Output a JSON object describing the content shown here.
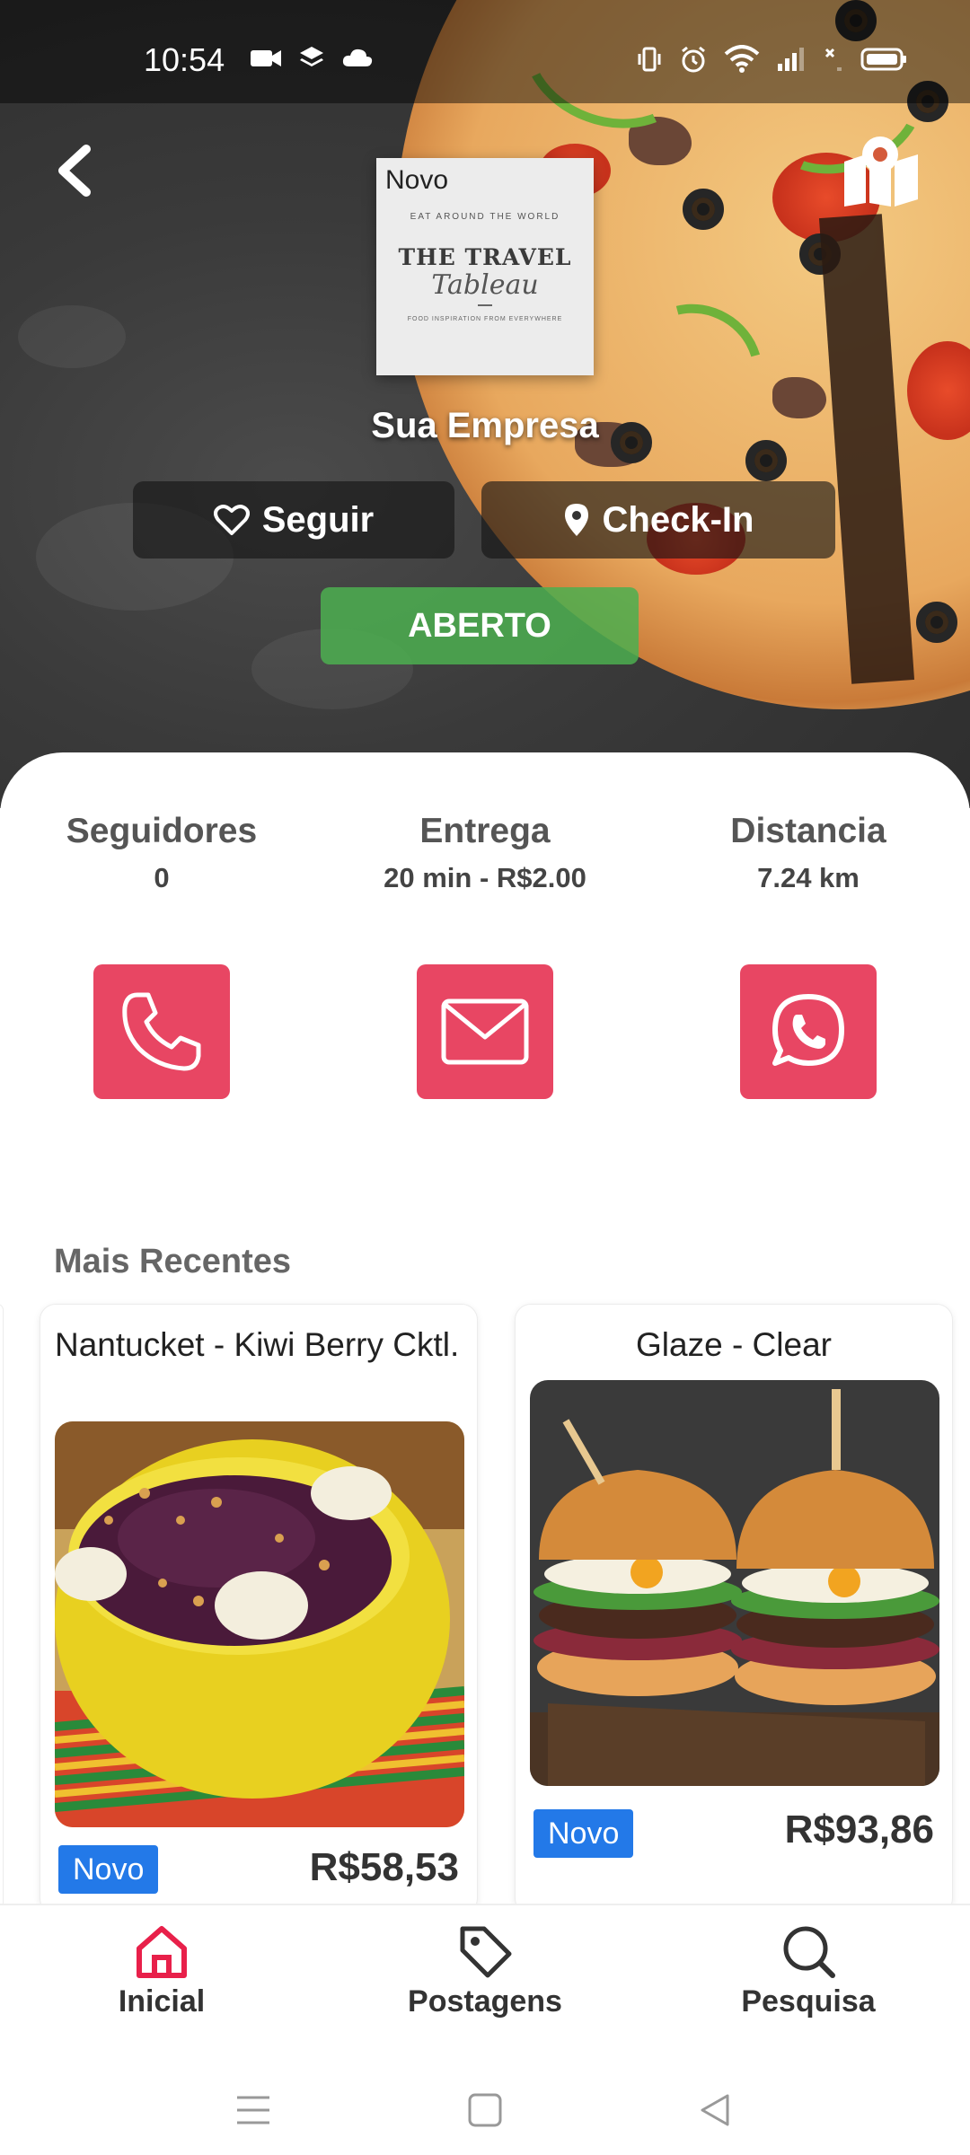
{
  "status_bar": {
    "time": "10:54"
  },
  "header": {
    "logo": {
      "badge": "Novo",
      "arc_text": "EAT AROUND THE WORLD",
      "main_text": "THE TRAVEL",
      "script_text": "Tableau",
      "tagline": "FOOD INSPIRATION FROM EVERYWHERE"
    },
    "company_name": "Sua Empresa",
    "follow_label": "Seguir",
    "checkin_label": "Check-In",
    "status_label": "ABERTO"
  },
  "stats": [
    {
      "label": "Seguidores",
      "value": "0"
    },
    {
      "label": "Entrega",
      "value": "20 min - R$2.00"
    },
    {
      "label": "Distancia",
      "value": "7.24 km"
    }
  ],
  "contacts": [
    "phone-icon",
    "mail-icon",
    "whatsapp-icon"
  ],
  "recent": {
    "title": "Mais Recentes",
    "items": [
      {
        "title": "Nantucket - Kiwi Berry Cktl.",
        "badge": "Novo",
        "price": "R$58,53"
      },
      {
        "title": "Glaze - Clear",
        "badge": "Novo",
        "price": "R$93,86"
      }
    ]
  },
  "nav": {
    "items": [
      {
        "label": "Inicial",
        "icon": "home-icon"
      },
      {
        "label": "Postagens",
        "icon": "tag-icon"
      },
      {
        "label": "Pesquisa",
        "icon": "search-icon"
      }
    ]
  },
  "colors": {
    "accent": "#e84663",
    "active_nav": "#e8204a",
    "open": "#4caf50",
    "badge": "#2379e8"
  }
}
